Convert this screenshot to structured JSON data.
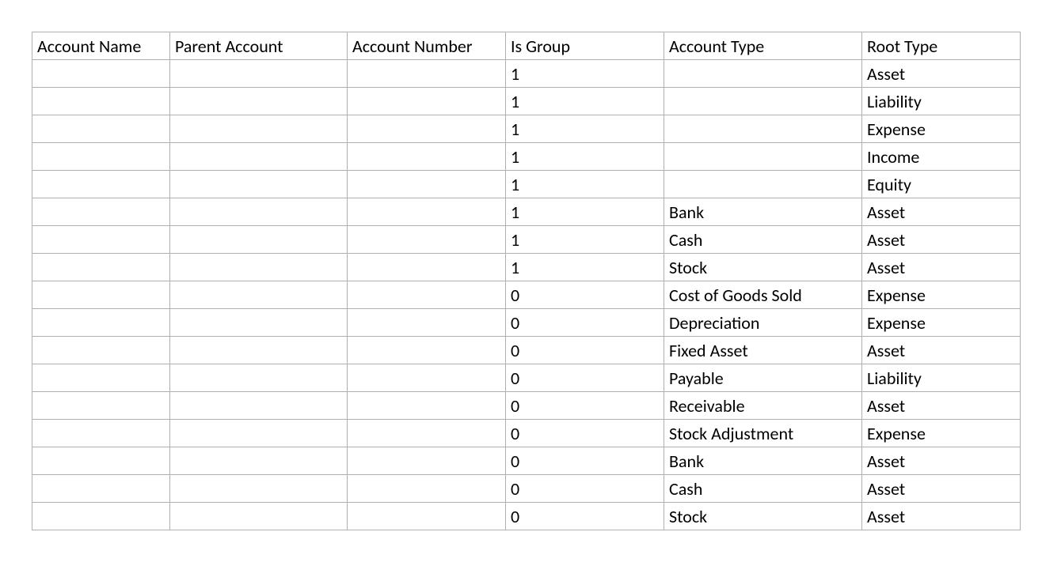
{
  "table": {
    "headers": [
      "Account Name",
      "Parent Account",
      "Account Number",
      "Is Group",
      "Account Type",
      "Root Type"
    ],
    "rows": [
      {
        "account_name": "",
        "parent_account": "",
        "account_number": "",
        "is_group": "1",
        "account_type": "",
        "root_type": "Asset"
      },
      {
        "account_name": "",
        "parent_account": "",
        "account_number": "",
        "is_group": "1",
        "account_type": "",
        "root_type": "Liability"
      },
      {
        "account_name": "",
        "parent_account": "",
        "account_number": "",
        "is_group": "1",
        "account_type": "",
        "root_type": "Expense"
      },
      {
        "account_name": "",
        "parent_account": "",
        "account_number": "",
        "is_group": "1",
        "account_type": "",
        "root_type": "Income"
      },
      {
        "account_name": "",
        "parent_account": "",
        "account_number": "",
        "is_group": "1",
        "account_type": "",
        "root_type": "Equity"
      },
      {
        "account_name": "",
        "parent_account": "",
        "account_number": "",
        "is_group": "1",
        "account_type": "Bank",
        "root_type": "Asset"
      },
      {
        "account_name": "",
        "parent_account": "",
        "account_number": "",
        "is_group": "1",
        "account_type": "Cash",
        "root_type": "Asset"
      },
      {
        "account_name": "",
        "parent_account": "",
        "account_number": "",
        "is_group": "1",
        "account_type": "Stock",
        "root_type": "Asset"
      },
      {
        "account_name": "",
        "parent_account": "",
        "account_number": "",
        "is_group": "0",
        "account_type": "Cost of Goods Sold",
        "root_type": "Expense"
      },
      {
        "account_name": "",
        "parent_account": "",
        "account_number": "",
        "is_group": "0",
        "account_type": "Depreciation",
        "root_type": "Expense"
      },
      {
        "account_name": "",
        "parent_account": "",
        "account_number": "",
        "is_group": "0",
        "account_type": "Fixed Asset",
        "root_type": "Asset"
      },
      {
        "account_name": "",
        "parent_account": "",
        "account_number": "",
        "is_group": "0",
        "account_type": "Payable",
        "root_type": "Liability"
      },
      {
        "account_name": "",
        "parent_account": "",
        "account_number": "",
        "is_group": "0",
        "account_type": "Receivable",
        "root_type": "Asset"
      },
      {
        "account_name": "",
        "parent_account": "",
        "account_number": "",
        "is_group": "0",
        "account_type": "Stock Adjustment",
        "root_type": "Expense"
      },
      {
        "account_name": "",
        "parent_account": "",
        "account_number": "",
        "is_group": "0",
        "account_type": "Bank",
        "root_type": "Asset"
      },
      {
        "account_name": "",
        "parent_account": "",
        "account_number": "",
        "is_group": "0",
        "account_type": "Cash",
        "root_type": "Asset"
      },
      {
        "account_name": "",
        "parent_account": "",
        "account_number": "",
        "is_group": "0",
        "account_type": "Stock",
        "root_type": "Asset"
      }
    ]
  }
}
